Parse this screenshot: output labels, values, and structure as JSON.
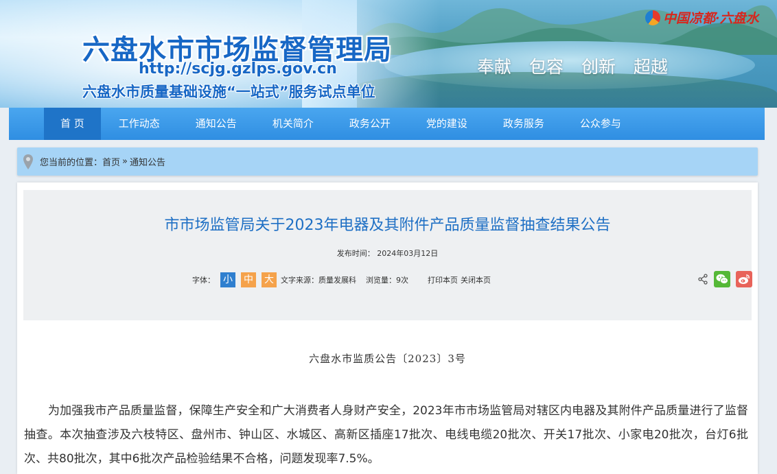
{
  "banner": {
    "title": "六盘水市市场监督管理局",
    "url": "http://scjg.gzlps.gov.cn",
    "subtitle": "六盘水市质量基础设施“一站式”服务试点单位",
    "slogans": [
      "奉献",
      "包容",
      "创新",
      "超越"
    ],
    "brand": "中国凉都·六盘水"
  },
  "nav": {
    "items": [
      "首 页",
      "工作动态",
      "通知公告",
      "机关简介",
      "政务公开",
      "党的建设",
      "政务服务",
      "公众参与"
    ]
  },
  "breadcrumb": {
    "prefix": "您当前的位置：",
    "home": "首页",
    "separator": "»",
    "current": "通知公告"
  },
  "article": {
    "title": "市市场监管局关于2023年电器及其附件产品质量监督抽查结果公告",
    "pub_time": "发布时间： 2024年03月12日",
    "font_label": "字体：",
    "size_small": "小",
    "size_mid": "中",
    "size_big": "大",
    "source": "文字来源：质量发展科",
    "views": "浏览量：9次",
    "print": "打印本页",
    "close": "关闭本页",
    "doc_number": "六盘水市监质公告〔2023〕3号",
    "paragraph": "为加强我市产品质量监督，保障生产安全和广大消费者人身财产安全，2023年市市场监管局对辖区内电器及其附件产品质量进行了监督抽查。本次抽查涉及六枝特区、盘州市、钟山区、水城区、高新区插座17批次、电线电缆20批次、开关17批次、小家电20批次，台灯6批次、共80批次，其中6批次产品检验结果不合格，问题发现率7.5%。"
  },
  "colors": {
    "nav_bg": "#3a9be8",
    "nav_active": "#1f74c8",
    "title_blue": "#1e6fc4",
    "breadcrumb_bg": "#a6d4f6",
    "wechat_green": "#55b837",
    "weibo_red": "#e8635a",
    "size_orange": "#f5a24b"
  }
}
